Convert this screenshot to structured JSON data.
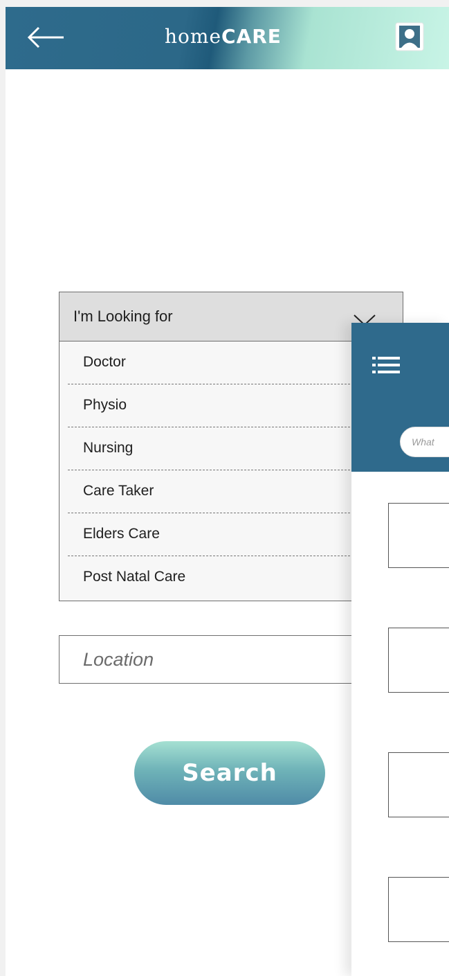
{
  "header": {
    "back_icon": "back-arrow-icon",
    "brand_part1": "home",
    "brand_part2": "CARE",
    "profile_icon": "profile-icon",
    "gradient_start": "#2e6b8c",
    "gradient_end": "#c8f4e6"
  },
  "dropdown": {
    "label": "I'm Looking for",
    "chevron_icon": "chevron-down-icon",
    "items": [
      {
        "label": "Doctor"
      },
      {
        "label": "Physio"
      },
      {
        "label": "Nursing"
      },
      {
        "label": "Care Taker"
      },
      {
        "label": "Elders Care"
      },
      {
        "label": "Post Natal Care"
      }
    ]
  },
  "location": {
    "placeholder": "Location",
    "value": ""
  },
  "search": {
    "label": "Search"
  },
  "panel": {
    "menu_icon": "hamburger-menu-icon",
    "search_placeholder": "What",
    "header_color": "#2f6a8c"
  }
}
